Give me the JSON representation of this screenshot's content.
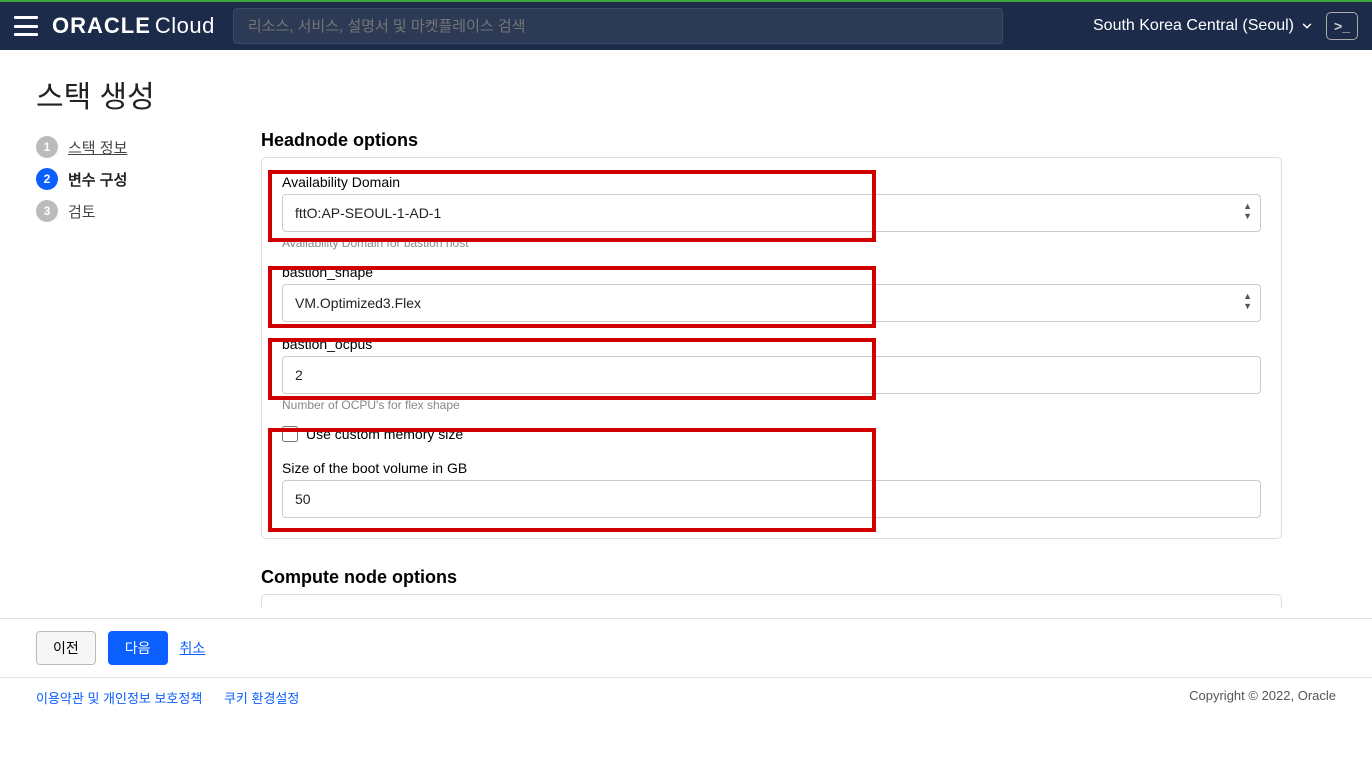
{
  "header": {
    "brand_strong": "ORACLE",
    "brand_light": "Cloud",
    "search_placeholder": "리소스, 서비스, 설명서 및 마켓플레이스 검색",
    "region": "South Korea Central (Seoul)"
  },
  "page": {
    "title": "스택 생성"
  },
  "wizard": {
    "steps": [
      {
        "num": "1",
        "label": "스택 정보",
        "link": true,
        "active": false
      },
      {
        "num": "2",
        "label": "변수 구성",
        "link": false,
        "active": true
      },
      {
        "num": "3",
        "label": "검토",
        "link": false,
        "active": false
      }
    ]
  },
  "headnode": {
    "heading": "Headnode options",
    "ad_label": "Availability Domain",
    "ad_value": "fttO:AP-SEOUL-1-AD-1",
    "ad_help": "Availability Domain for bastion host",
    "shape_label": "bastion_shape",
    "shape_value": "VM.Optimized3.Flex",
    "ocpu_label": "bastion_ocpus",
    "ocpu_value": "2",
    "ocpu_help": "Number of OCPU's for flex shape",
    "custom_mem_label": "Use custom memory size",
    "boot_label": "Size of the boot volume in GB",
    "boot_value": "50"
  },
  "compute": {
    "heading": "Compute node options"
  },
  "buttons": {
    "prev": "이전",
    "next": "다음",
    "cancel": "취소"
  },
  "footer": {
    "terms": "이용약관 및 개인정보 보호정책",
    "cookies": "쿠키 환경설정",
    "copyright": "Copyright © 2022, Oracle"
  }
}
